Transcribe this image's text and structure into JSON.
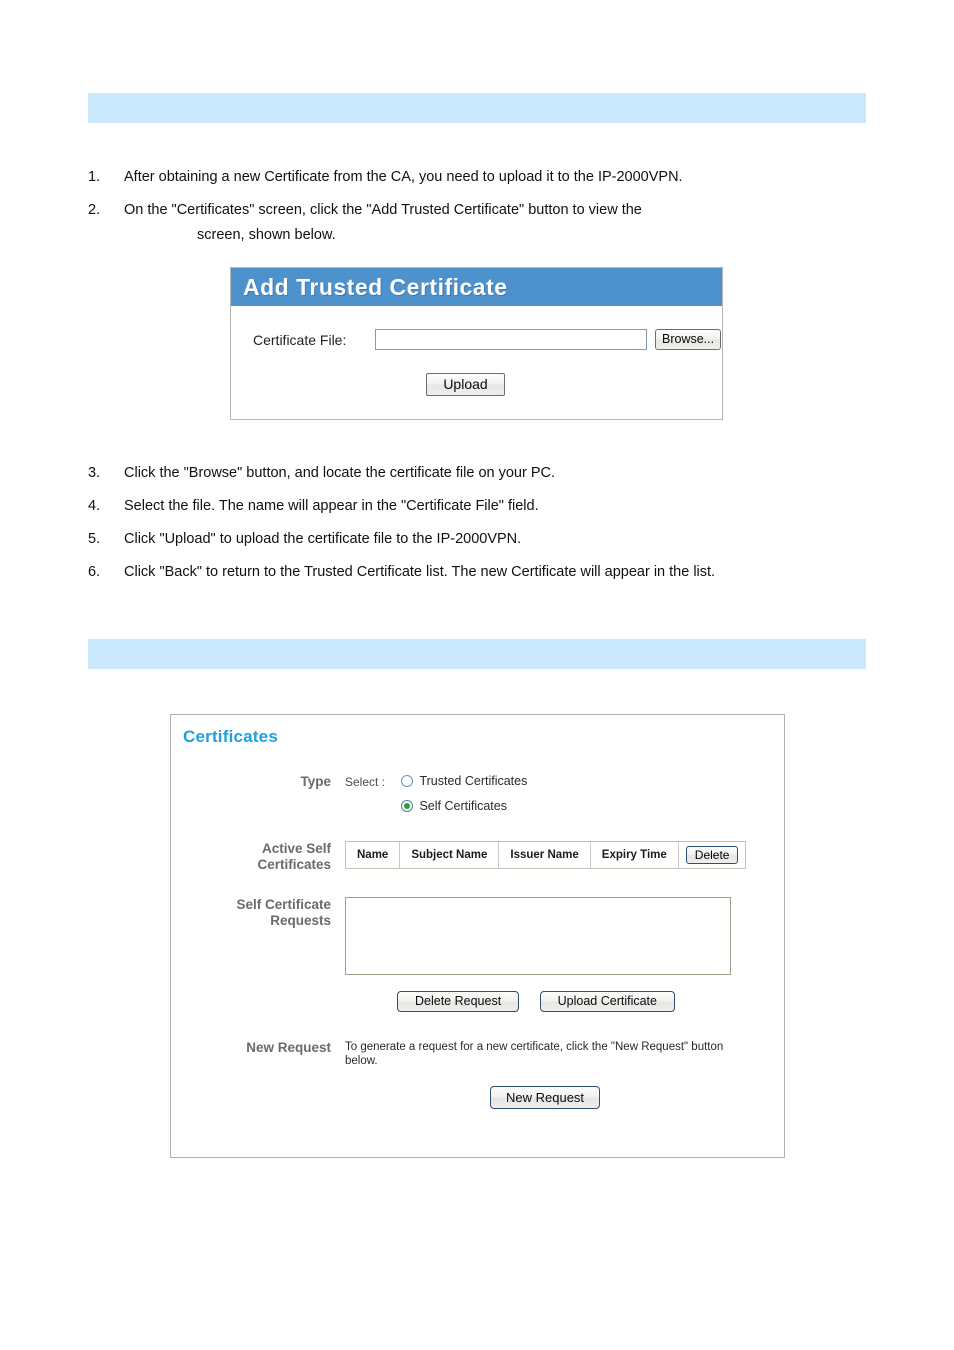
{
  "page": {
    "section_bar_1_label": "",
    "section_bar_2_label": "",
    "accent_blue": "#c9e8fb",
    "heading_blue": "#1ba1e2",
    "titlebar_blue": "#4e92cd"
  },
  "steps_upper": [
    {
      "num": "1.",
      "text": "After obtaining a new Certificate from the CA, you need to upload it to the IP-2000VPN.",
      "continuation": ""
    },
    {
      "num": "2.",
      "text": "On the \"Certificates\" screen, click the \"Add Trusted Certificate\" button to view the",
      "continuation": "screen, shown below."
    }
  ],
  "steps_lower": [
    {
      "num": "3.",
      "text": "Click the \"Browse\" button, and locate the certificate file on your PC.",
      "continuation": ""
    },
    {
      "num": "4.",
      "text": "Select the file. The name will appear in the \"Certificate File\" field.",
      "continuation": ""
    },
    {
      "num": "5.",
      "text": "Click \"Upload\" to upload the certificate file to the IP-2000VPN.",
      "continuation": ""
    },
    {
      "num": "6.",
      "text": "Click \"Back\" to return to the Trusted Certificate list. The new Certificate will appear in the list.",
      "continuation": ""
    }
  ],
  "add_trusted_certificate": {
    "title": "Add Trusted Certificate",
    "certificate_file_label": "Certificate File:",
    "certificate_file_value": "",
    "certificate_file_placeholder": "",
    "browse_label": "Browse...",
    "upload_label": "Upload"
  },
  "certificates_panel": {
    "heading": "Certificates",
    "type": {
      "label": "Type",
      "select_label": "Select :",
      "options": [
        {
          "label": "Trusted Certificates",
          "selected": false
        },
        {
          "label": "Self Certificates",
          "selected": true
        }
      ]
    },
    "active_self_certificates": {
      "label": "Active Self Certificates",
      "label_line1": "Active Self",
      "label_line2": "Certificates",
      "columns": [
        "Name",
        "Subject Name",
        "Issuer Name",
        "Expiry Time"
      ],
      "rows": [],
      "delete_label": "Delete"
    },
    "self_certificate_requests": {
      "label_line1": "Self Certificate",
      "label_line2": "Requests",
      "value": "",
      "delete_request_label": "Delete Request",
      "upload_certificate_label": "Upload Certificate"
    },
    "new_request": {
      "label": "New Request",
      "description": "To generate a request for a new certificate, click the \"New Request\" button below.",
      "button_label": "New Request"
    }
  }
}
